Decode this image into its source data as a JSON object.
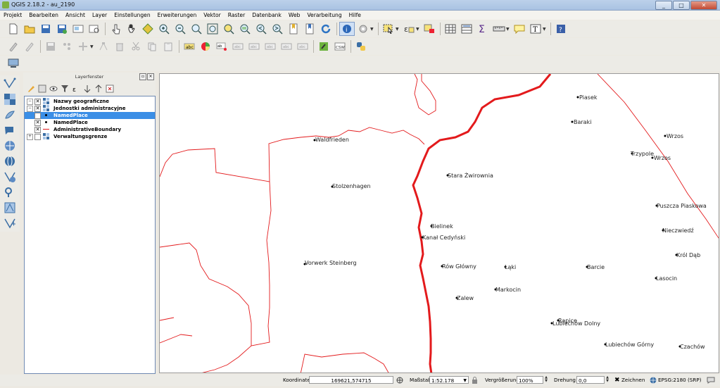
{
  "window": {
    "title": "QGIS 2.18.2 - au_2190",
    "buttons": [
      "_",
      "□",
      "✕"
    ]
  },
  "menu": [
    "Projekt",
    "Bearbeiten",
    "Ansicht",
    "Layer",
    "Einstellungen",
    "Erweiterungen",
    "Vektor",
    "Raster",
    "Datenbank",
    "Web",
    "Verarbeitung",
    "Hilfe"
  ],
  "icons": {
    "toolbar1": [
      "new-project-icon",
      "open-project-icon",
      "save-project-icon",
      "save-as-icon",
      "print-composer-icon",
      "composer-manager-icon",
      "touch-zoom-icon",
      "pan-icon",
      "pan-to-selection-icon",
      "zoom-in-icon",
      "zoom-out-icon",
      "zoom-actual-icon",
      "zoom-full-icon",
      "zoom-selection-icon",
      "zoom-layer-icon",
      "zoom-last-icon",
      "zoom-next-icon",
      "new-bookmark-icon",
      "show-bookmarks-icon",
      "refresh-icon",
      "identify-icon",
      "run-action-icon",
      "select-feature-icon",
      "select-value-icon",
      "deselect-icon",
      "attribute-table-icon",
      "field-calculator-icon",
      "statistics-icon",
      "measure-icon",
      "map-tips-icon",
      "text-annotation-icon",
      "help-icon"
    ],
    "toolbar2": [
      "current-edits-icon",
      "toggle-editing-icon",
      "save-edits-icon",
      "add-feature-icon",
      "move-feature-icon",
      "node-tool-icon",
      "delete-selected-icon",
      "cut-features-icon",
      "copy-features-icon",
      "paste-features-icon",
      "label-icon",
      "diagram-icon",
      "pin-labels-icon",
      "show-hide-labels-icon",
      "move-label-icon",
      "rotate-label-icon",
      "change-label-icon",
      "label-toolbar-icon",
      "inspire-plugin-icon",
      "csw-icon",
      "python-console-icon"
    ],
    "toolbar3": [
      "coordinate-capture-icon"
    ],
    "left": [
      "add-vector-layer-icon",
      "add-raster-layer-icon",
      "add-postgis-layer-icon",
      "add-spatialite-layer-icon",
      "add-mssql-layer-icon",
      "add-oracle-layer-icon",
      "add-wms-layer-icon",
      "add-wcs-layer-icon",
      "add-wfs-layer-icon",
      "new-shapefile-icon"
    ]
  },
  "layer_panel": {
    "title": "Layerfenster",
    "tools": [
      "style-icon",
      "add-group-icon",
      "manage-visibility-icon",
      "filter-legend-icon",
      "filter-expression-icon",
      "expand-all-icon",
      "collapse-all-icon",
      "remove-layer-icon"
    ],
    "rows": [
      {
        "label": "Nazwy geograficzne",
        "expanded": true,
        "checked": true,
        "selected": false,
        "indent": 0,
        "icon": "raster-grid-icon"
      },
      {
        "label": "Jednostki administracyjne",
        "expanded": true,
        "checked": true,
        "selected": false,
        "indent": 0,
        "icon": "raster-grid-icon"
      },
      {
        "label": "NamedPlace",
        "expanded": false,
        "checked": false,
        "selected": true,
        "indent": 1,
        "icon": "point-layer-icon"
      },
      {
        "label": "NamedPlace",
        "expanded": false,
        "checked": true,
        "selected": false,
        "indent": 1,
        "icon": "point-layer-icon"
      },
      {
        "label": "AdministrativeBoundary",
        "expanded": false,
        "checked": true,
        "selected": false,
        "indent": 1,
        "icon": "line-layer-icon"
      },
      {
        "label": "Verwaltungsgrenze",
        "expanded": true,
        "checked": false,
        "selected": false,
        "indent": 0,
        "icon": "raster-grid-icon"
      }
    ]
  },
  "map": {
    "boundary_color": "#e31a1c",
    "places": [
      "Piasek",
      "Baraki",
      "Wrzos",
      "Trzypole",
      "Wrzos",
      "Waldfrieden",
      "Stolzenhagen",
      "Stara Żwirownia",
      "Puszcza Piaskowa",
      "Nieczwiedź",
      "Bielinek",
      "Kanał Cedyński",
      "Król Dąb",
      "Vorwerk Steinberg",
      "Rów Główny",
      "Łąki",
      "Barcie",
      "Lasocin",
      "Markocin",
      "Zalew",
      "Rapice",
      "Lubiechów Dolny",
      "Lubiechów Górny",
      "Czachów"
    ]
  },
  "status": {
    "coord_label": "Koordinate",
    "coord_value": "169621,574715",
    "scale_label": "Maßstab",
    "scale_value": "1:52.178",
    "magnifier_label": "Vergrößerung",
    "magnifier_value": "100%",
    "rotation_label": "Drehung",
    "rotation_value": "0,0",
    "render_label": "Zeichnen",
    "crs_label": "EPSG:2180 (SRP)"
  }
}
